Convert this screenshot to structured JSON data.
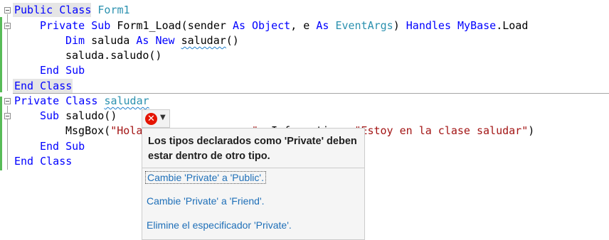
{
  "code_lines": [
    {
      "t1": "Public",
      "t2": " ",
      "t3": "Class",
      "t4": " ",
      "t5": "Form1"
    },
    {
      "a": "Private",
      "b": " ",
      "c": "Sub",
      "d": " Form1_Load(sender ",
      "e": "As",
      "f": " ",
      "g": "Object",
      "h": ", e ",
      "i": "As",
      "j": " ",
      "k": "EventArgs",
      "l": ") ",
      "m": "Handles",
      "n": " ",
      "o": "MyBase",
      "p": ".Load"
    },
    {
      "a": "Dim",
      "b": " saluda ",
      "c": "As",
      "d": " ",
      "e": "New",
      "f": " ",
      "g": "saludar",
      "h": "()"
    },
    {
      "a": "saluda.saludo()"
    },
    {
      "a": "End",
      "b": " ",
      "c": "Sub"
    },
    {
      "a": "End",
      "b": " ",
      "c": "Class"
    },
    {
      "a": "Private",
      "b": " ",
      "c": "Class",
      "d": " ",
      "e": "saludar"
    },
    {
      "a": "Sub",
      "b": " saludo()"
    },
    {
      "a": "MsgBox(",
      "b": "\"Hola",
      "c": "                 ",
      "d": "\"",
      "e": ", ",
      "f": "Information, ",
      "g": "\"Estoy en la clase saludar\"",
      "h": ")"
    },
    {
      "a": "End",
      "b": " ",
      "c": "Sub"
    },
    {
      "a": "End",
      "b": " ",
      "c": "Class"
    }
  ],
  "quick_actions": {
    "error_icon": "x-circle-icon",
    "dropdown_icon": "chevron-down-icon",
    "message": "Los tipos declarados como 'Private' deben estar dentro de otro tipo.",
    "fixes": [
      "Cambie 'Private' a 'Public'.",
      "Cambie 'Private' a 'Friend'.",
      "Elimine el especificador 'Private'."
    ]
  },
  "colors": {
    "keyword": "#0000ff",
    "type": "#2b91af",
    "string": "#a31515",
    "error": "#e51400",
    "change_bar": "#57bb57",
    "link": "#1e6fb8"
  }
}
